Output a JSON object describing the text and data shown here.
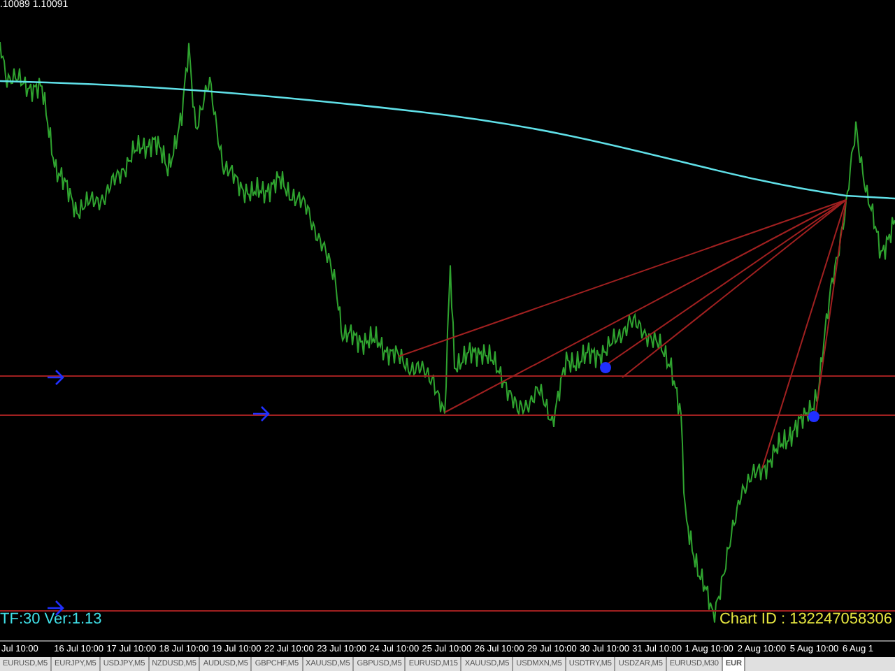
{
  "chart": {
    "quote": ".10089 1.10091",
    "indicator_label": "TF:30 Ver:1.13",
    "chart_id": "Chart ID : 132247058306"
  },
  "time_axis": [
    "Jul 10:00",
    "16 Jul 10:00",
    "17 Jul 10:00",
    "18 Jul 10:00",
    "19 Jul 10:00",
    "22 Jul 10:00",
    "23 Jul 10:00",
    "24 Jul 10:00",
    "25 Jul 10:00",
    "26 Jul 10:00",
    "29 Jul 10:00",
    "30 Jul 10:00",
    "31 Jul 10:00",
    "1 Aug 10:00",
    "2 Aug 10:00",
    "5 Aug 10:00",
    "6 Aug 1"
  ],
  "tabs": [
    {
      "label": "EURUSD,M5",
      "selected": false
    },
    {
      "label": "EURJPY,M5",
      "selected": false
    },
    {
      "label": "USDJPY,M5",
      "selected": false
    },
    {
      "label": "NZDUSD,M5",
      "selected": false
    },
    {
      "label": "AUDUSD,M5",
      "selected": false
    },
    {
      "label": "GBPCHF,M5",
      "selected": false
    },
    {
      "label": "XAUUSD,M5",
      "selected": false
    },
    {
      "label": "GBPUSD,M5",
      "selected": false
    },
    {
      "label": "EURUSD,M15",
      "selected": false
    },
    {
      "label": "XAUUSD,M5",
      "selected": false
    },
    {
      "label": "USDMXN,M5",
      "selected": false
    },
    {
      "label": "USDTRY,M5",
      "selected": false
    },
    {
      "label": "USDZAR,M5",
      "selected": false
    },
    {
      "label": "EURUSD,M30",
      "selected": false
    },
    {
      "label": "EUR",
      "selected": true
    }
  ]
}
